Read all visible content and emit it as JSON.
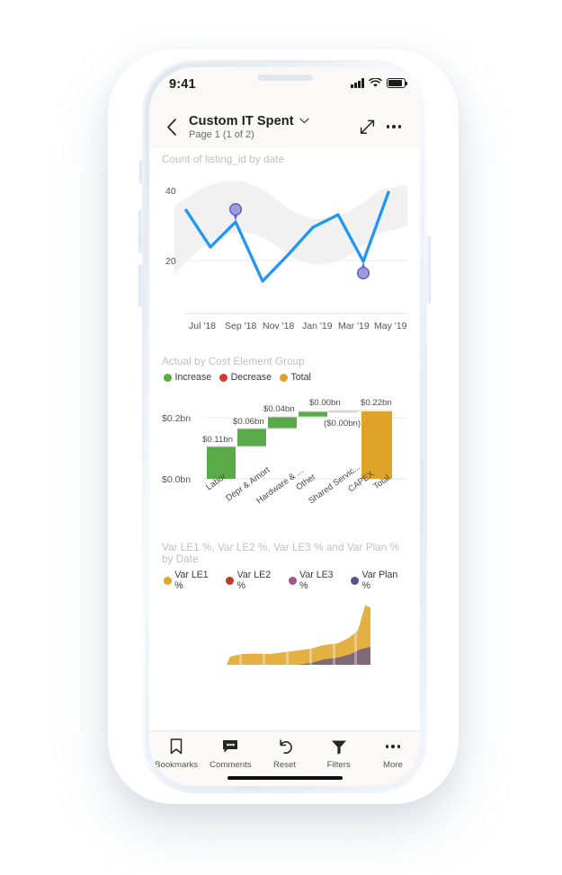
{
  "status_bar": {
    "time": "9:41",
    "signal_icon": "cellular-signal-icon",
    "wifi_icon": "wifi-icon",
    "battery_icon": "battery-icon"
  },
  "header": {
    "back_icon": "chevron-left-icon",
    "title": "Custom IT Spent",
    "title_chevron_icon": "chevron-down-icon",
    "subtitle": "Page 1 (1 of 2)",
    "expand_icon": "expand-arrows-icon",
    "more_icon": "more-horizontal-icon"
  },
  "charts": {
    "line": {
      "title": "Count of listing_id by date",
      "accent_color": "#2196f3",
      "band_color": "#f0f0f0",
      "marker_color": "#6b6ecf"
    },
    "waterfall": {
      "title": "Actual by Cost Element Group",
      "legend": [
        {
          "label": "Increase",
          "color": "#5aaa4a"
        },
        {
          "label": "Decrease",
          "color": "#d63b32"
        },
        {
          "label": "Total",
          "color": "#dfa32a"
        }
      ]
    },
    "area": {
      "title": "Var LE1 %, Var LE2 %, Var LE3 % and Var Plan % by Date",
      "legend": [
        {
          "label": "Var LE1 %",
          "color": "#e0a72c"
        },
        {
          "label": "Var LE2 %",
          "color": "#c0392b"
        },
        {
          "label": "Var LE3 %",
          "color": "#a5558a"
        },
        {
          "label": "Var Plan %",
          "color": "#5b4f8e"
        }
      ]
    }
  },
  "chart_data": [
    {
      "type": "line",
      "title": "Count of listing_id by date",
      "xlabel": "",
      "ylabel": "",
      "ylim": [
        10,
        42
      ],
      "yticks": [
        20,
        40
      ],
      "ytick_labels": [
        "20",
        "40"
      ],
      "grid": false,
      "x": [
        "Jul '18",
        "Sep '18",
        "Nov '18",
        "Jan '19",
        "Mar '19",
        "May '19"
      ],
      "tick_labels": [
        "Jul '18",
        "Sep '18",
        "Nov '18",
        "Jan '19",
        "Mar '19",
        "May '19"
      ],
      "series": [
        {
          "name": "Count of listing_id",
          "color": "#2196f3",
          "points": [
            33,
            21.5,
            28,
            15,
            25,
            32.5,
            35.5,
            20,
            40
          ]
        }
      ],
      "anomaly_markers": [
        {
          "x_index": 2,
          "value": 28,
          "label": "",
          "color": "#6b6ecf"
        },
        {
          "x_index": 7,
          "value": 20,
          "label": "",
          "color": "#6b6ecf"
        }
      ],
      "band": {
        "name": "expected range",
        "color": "#f0f0f0"
      }
    },
    {
      "type": "bar",
      "subtype": "waterfall",
      "title": "Actual by Cost Element Group",
      "xlabel": "",
      "ylabel": "",
      "ylim": [
        0,
        0.24
      ],
      "yticks": [
        0.0,
        0.2
      ],
      "ytick_labels": [
        "$0.0bn",
        "$0.2bn"
      ],
      "categories": [
        "Labor",
        "Depr & Amort",
        "Hardware & ...",
        "Other",
        "Shared Servic...",
        "CAPEX",
        "Total"
      ],
      "values": [
        0.11,
        0.06,
        0.04,
        0.01,
        0.0,
        -0.0,
        0.22
      ],
      "data_labels": [
        "$0.11bn",
        "$0.06bn",
        "$0.04bn",
        "$0.00bn",
        "",
        "($0.00bn)",
        "$0.22bn"
      ],
      "bar_types": [
        "increase",
        "increase",
        "increase",
        "increase",
        "increase",
        "decrease",
        "total"
      ],
      "legend": [
        "Increase",
        "Decrease",
        "Total"
      ],
      "legend_colors": [
        "#5aaa4a",
        "#d63b32",
        "#dfa32a"
      ]
    },
    {
      "type": "area",
      "title": "Var LE1 %, Var LE2 %, Var LE3 % and Var Plan % by Date",
      "xlabel": "",
      "ylabel": "",
      "stacked": true,
      "grid": false,
      "series": [
        {
          "name": "Var LE1 %",
          "color": "#e0a72c",
          "values": [
            0,
            5,
            6,
            7,
            7,
            7.5,
            7,
            7,
            7,
            7.5,
            8,
            9,
            10,
            11,
            12,
            13,
            15,
            18,
            24,
            45,
            38
          ]
        },
        {
          "name": "Var LE2 %",
          "color": "#c0392b",
          "values": [
            0,
            0,
            0,
            0,
            0,
            0,
            0,
            0,
            0,
            0,
            0,
            0,
            0,
            0,
            0,
            0,
            0,
            0,
            0,
            0,
            0
          ]
        },
        {
          "name": "Var LE3 %",
          "color": "#a5558a",
          "values": [
            0,
            0,
            0,
            0,
            0,
            0,
            0,
            0,
            0,
            0,
            0,
            0,
            0,
            0,
            0,
            0,
            0,
            0,
            0,
            0,
            0
          ]
        },
        {
          "name": "Var Plan %",
          "color": "#5b4f8e",
          "values": [
            0,
            0,
            0,
            0,
            0,
            0,
            0,
            0,
            0,
            0,
            0,
            1,
            2,
            3,
            4,
            5,
            6,
            8,
            11,
            14,
            14
          ]
        }
      ]
    }
  ],
  "bottom_nav": [
    {
      "label": "Bookmarks",
      "icon": "bookmark-icon"
    },
    {
      "label": "Comments",
      "icon": "comment-icon"
    },
    {
      "label": "Reset",
      "icon": "undo-arrow-icon"
    },
    {
      "label": "Filters",
      "icon": "funnel-icon"
    },
    {
      "label": "More",
      "icon": "more-horizontal-icon"
    }
  ]
}
